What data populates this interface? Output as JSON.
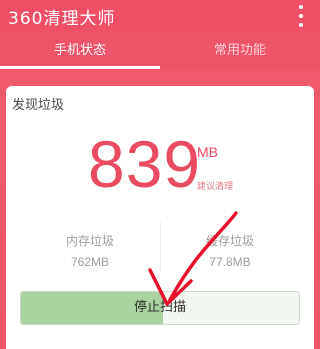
{
  "app": {
    "title": "360清理大师"
  },
  "tabs": [
    {
      "label": "手机状态",
      "active": true
    },
    {
      "label": "常用功能",
      "active": false
    }
  ],
  "scan": {
    "section_title": "发现垃圾",
    "amount": "839",
    "unit": "MB",
    "suggestion": "建议清理",
    "memory": {
      "label": "内存垃圾",
      "value": "762MB"
    },
    "cache": {
      "label": "缓存垃圾",
      "value": "77.8MB"
    },
    "stop_label": "停止扫描",
    "progress_fraction": 0.51
  },
  "icons": {
    "menu": "more-vertical-icon",
    "annotation": "red-arrow-icon"
  },
  "colors": {
    "accent": "#ef5065",
    "number": "#e94b62",
    "progress": "#a9d2a0",
    "annotation": "#e8112d"
  }
}
